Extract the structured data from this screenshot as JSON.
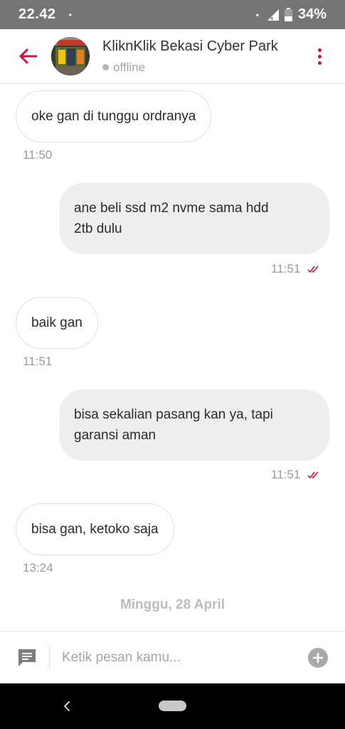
{
  "status_bar": {
    "time": "22.42",
    "left_dot": "•",
    "right_dot": "•",
    "battery": "34%"
  },
  "header": {
    "title": "KliknKlik Bekasi Cyber Park",
    "status": "offline",
    "accent_color": "#d0103a"
  },
  "messages": [
    {
      "direction": "in",
      "text": "oke gan di tunggu ordranya",
      "time": "11:50"
    },
    {
      "direction": "out",
      "line1": "ane beli ssd m2 nvme sama hdd",
      "line2": "2tb dulu",
      "time": "11:51",
      "read": true
    },
    {
      "direction": "in",
      "text": "baik gan",
      "time": "11:51"
    },
    {
      "direction": "out",
      "line1": "bisa sekalian pasang kan ya, tapi",
      "line2": "garansi aman",
      "time": "11:51",
      "read": true
    },
    {
      "direction": "in",
      "text": "bisa gan, ketoko saja",
      "time": "13:24"
    }
  ],
  "date_separator": "Minggu, 28 April",
  "composer": {
    "placeholder": "Ketik pesan kamu..."
  },
  "icons": {
    "back": "arrow-left-icon",
    "menu": "more-vertical-icon",
    "read_receipt": "double-check-icon",
    "composer_left": "chat-template-icon",
    "composer_right": "plus-circle-icon"
  }
}
